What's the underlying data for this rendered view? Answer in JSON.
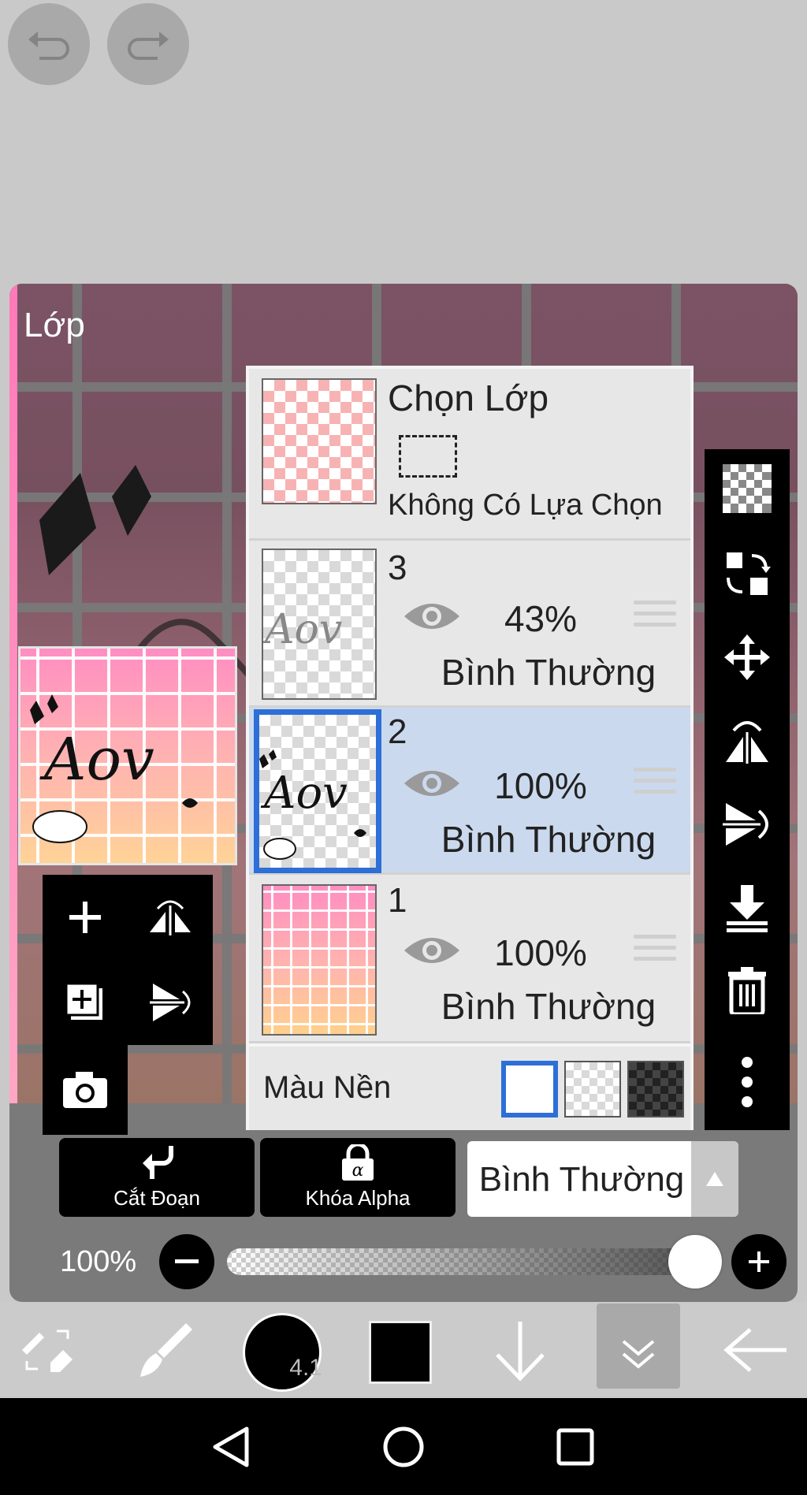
{
  "panel": {
    "title": "Lớp"
  },
  "selection_layer": {
    "title": "Chọn Lớp",
    "subtitle": "Không Có Lựa Chọn"
  },
  "layers": [
    {
      "number": "3",
      "opacity": "43%",
      "blend_mode": "Bình Thường",
      "selected": false
    },
    {
      "number": "2",
      "opacity": "100%",
      "blend_mode": "Bình Thường",
      "selected": true
    },
    {
      "number": "1",
      "opacity": "100%",
      "blend_mode": "Bình Thường",
      "selected": false
    }
  ],
  "background": {
    "label": "Màu Nền",
    "options": [
      "white",
      "transparent",
      "dark-checker"
    ],
    "selected": "white"
  },
  "controls": {
    "clip_label": "Cắt Đoạn",
    "alpha_lock_label": "Khóa Alpha",
    "blend_mode_value": "Bình Thường",
    "opacity_label": "100%",
    "opacity_value": 1.0
  },
  "toolbar": {
    "brush_size": "4.1",
    "current_color": "#000000"
  },
  "colors": {
    "accent": "#2d6fd6",
    "selected_row": "#cbd9ee",
    "panel_bg": "#e7e7e7"
  }
}
